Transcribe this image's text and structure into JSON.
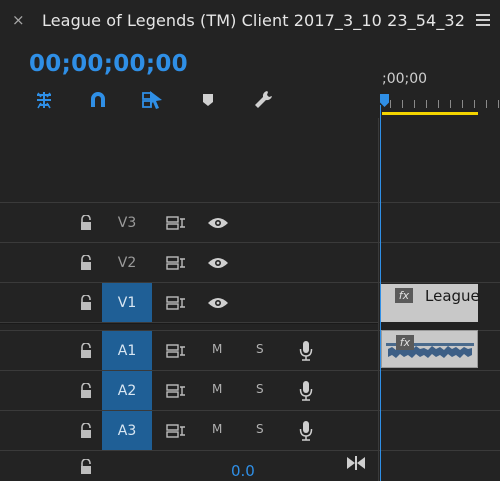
{
  "panel": {
    "title": "League of Legends (TM) Client 2017_3_10 23_54_32",
    "close_glyph": "×",
    "menu_icon": "hamburger-menu-icon"
  },
  "timecode": "00;00;00;00",
  "ruler": {
    "time_label": ";00;00"
  },
  "tools": [
    "snap-icon",
    "linked-selection-icon",
    "add-marker-icon",
    "marker-icon",
    "wrench-icon"
  ],
  "tracks": {
    "v3": {
      "name": "V3"
    },
    "v2": {
      "name": "V2"
    },
    "v1": {
      "name": "V1"
    },
    "a1": {
      "name": "A1",
      "mute": "M",
      "solo": "S"
    },
    "a2": {
      "name": "A2",
      "mute": "M",
      "solo": "S"
    },
    "a3": {
      "name": "A3",
      "mute": "M",
      "solo": "S"
    }
  },
  "master": {
    "value": "0.0"
  },
  "clips": {
    "video": {
      "fx": "fx",
      "label": "League"
    },
    "audio": {
      "fx": "fx"
    }
  },
  "colors": {
    "accent": "#2f8fe6",
    "active_track": "#1f5f96",
    "work_area": "#f3d400",
    "clip": "#c8c8c8"
  }
}
